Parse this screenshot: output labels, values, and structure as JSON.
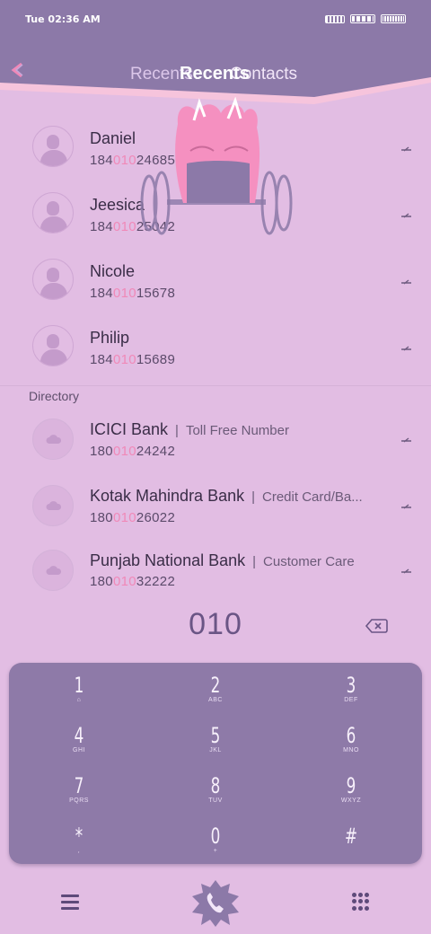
{
  "status_bar": {
    "time": "Tue 02:36 AM"
  },
  "header": {
    "tab_recents_ghost": "Recents",
    "tab_contacts": "Contacts",
    "tab_recents": "Recents"
  },
  "contacts": [
    {
      "name": "Daniel",
      "num_pre": "184",
      "num_hl": "010",
      "num_post": "24685"
    },
    {
      "name": "Jeesica",
      "num_pre": "184",
      "num_hl": "010",
      "num_post": "25042"
    },
    {
      "name": "Nicole",
      "num_pre": "184",
      "num_hl": "010",
      "num_post": "15678"
    },
    {
      "name": "Philip",
      "num_pre": "184",
      "num_hl": "010",
      "num_post": "15689"
    }
  ],
  "directory": {
    "label": "Directory",
    "items": [
      {
        "name": "ICICI Bank",
        "desc": "Toll Free Number",
        "num_pre": "180",
        "num_hl": "010",
        "num_post": "24242"
      },
      {
        "name": "Kotak Mahindra Bank",
        "desc": "Credit Card/Ba...",
        "num_pre": "180",
        "num_hl": "010",
        "num_post": "26022"
      },
      {
        "name": "Punjab National Bank",
        "desc": "Customer Care",
        "num_pre": "180",
        "num_hl": "010",
        "num_post": "32222"
      }
    ]
  },
  "dialer": {
    "dialed": "010",
    "keys": [
      {
        "digit": "1",
        "letters": "⌂"
      },
      {
        "digit": "2",
        "letters": "ABC"
      },
      {
        "digit": "3",
        "letters": "DEF"
      },
      {
        "digit": "4",
        "letters": "GHI"
      },
      {
        "digit": "5",
        "letters": "JKL"
      },
      {
        "digit": "6",
        "letters": "MNO"
      },
      {
        "digit": "7",
        "letters": "PQRS"
      },
      {
        "digit": "8",
        "letters": "TUV"
      },
      {
        "digit": "9",
        "letters": "WXYZ"
      },
      {
        "digit": "*",
        "letters": ","
      },
      {
        "digit": "0",
        "letters": "+"
      },
      {
        "digit": "#",
        "letters": ""
      }
    ]
  },
  "colors": {
    "status_bar": "#8c79a8",
    "background": "#e2bde3",
    "highlight": "#f089b8",
    "keypad": "#8e7aa8",
    "header_accent": "#f6c4dc"
  },
  "icons": {
    "back": "back-arrow-icon",
    "backspace": "backspace-icon",
    "menu": "menu-icon",
    "call": "phone-icon",
    "keypad": "dialpad-icon"
  }
}
